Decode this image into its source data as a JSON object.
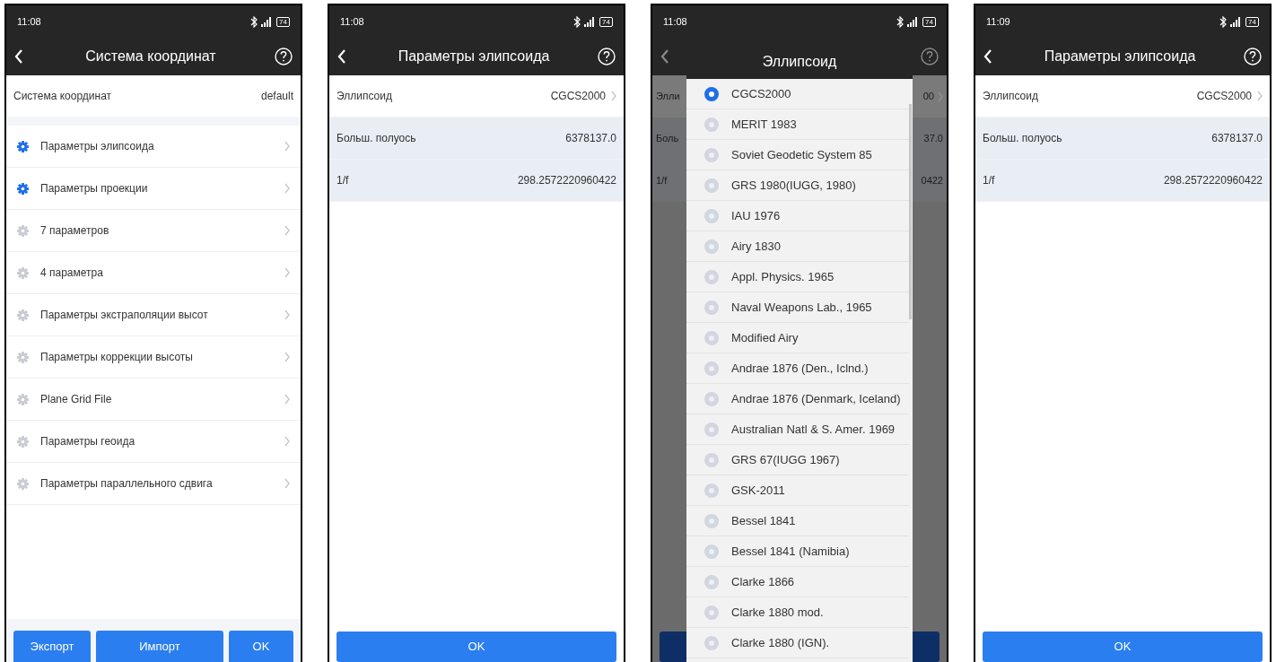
{
  "screens": [
    {
      "kind": "menu",
      "status": {
        "time": "11:08",
        "battery": "74"
      },
      "title": "Система координат",
      "header_row": {
        "label": "Система координат",
        "value": "default"
      },
      "items": [
        {
          "label": "Параметры элипсоида",
          "enabled": true
        },
        {
          "label": "Параметры проекции",
          "enabled": true
        },
        {
          "label": "7 параметров",
          "enabled": false
        },
        {
          "label": "4 параметра",
          "enabled": false
        },
        {
          "label": "Параметры экстраполяции высот",
          "enabled": false
        },
        {
          "label": "Параметры коррекции высоты",
          "enabled": false
        },
        {
          "label": "Plane Grid File",
          "enabled": false
        },
        {
          "label": "Параметры геоида",
          "enabled": false
        },
        {
          "label": "Параметры параллельного сдвига",
          "enabled": false
        }
      ],
      "buttons": [
        "Экспорт",
        "Импорт",
        "OK"
      ]
    },
    {
      "kind": "params",
      "status": {
        "time": "11:08",
        "battery": "74"
      },
      "title": "Параметры элипсоида",
      "rows": [
        {
          "kind": "select",
          "label": "Эллипсоид",
          "value": "CGCS2000"
        },
        {
          "kind": "value",
          "label": "Больш. полуось",
          "value": "6378137.0"
        },
        {
          "kind": "value",
          "label": "1/f",
          "value": "298.2572220960422"
        }
      ],
      "ok": "OK"
    },
    {
      "kind": "dialog",
      "status": {
        "time": "11:08",
        "battery": "74"
      },
      "background_rows": [
        {
          "kind": "select",
          "label": "Элли",
          "value": "00"
        },
        {
          "kind": "value",
          "label": "Боль",
          "value": "37.0"
        },
        {
          "kind": "value",
          "label": "1/f",
          "value": "0422"
        }
      ],
      "dialog": {
        "title": "Эллипсоид",
        "options": [
          {
            "label": "CGCS2000",
            "selected": true
          },
          {
            "label": "MERIT 1983",
            "selected": false
          },
          {
            "label": "Soviet Geodetic System 85",
            "selected": false
          },
          {
            "label": "GRS 1980(IUGG, 1980)",
            "selected": false
          },
          {
            "label": "IAU 1976",
            "selected": false
          },
          {
            "label": "Airy 1830",
            "selected": false
          },
          {
            "label": "Appl. Physics. 1965",
            "selected": false
          },
          {
            "label": "Naval Weapons Lab., 1965",
            "selected": false
          },
          {
            "label": "Modified Airy",
            "selected": false
          },
          {
            "label": "Andrae 1876 (Den., Iclnd.)",
            "selected": false
          },
          {
            "label": "Andrae 1876 (Denmark, Iceland)",
            "selected": false
          },
          {
            "label": "Australian Natl & S. Amer. 1969",
            "selected": false
          },
          {
            "label": "GRS 67(IUGG 1967)",
            "selected": false
          },
          {
            "label": "GSK-2011",
            "selected": false
          },
          {
            "label": "Bessel 1841",
            "selected": false
          },
          {
            "label": "Bessel 1841 (Namibia)",
            "selected": false
          },
          {
            "label": "Clarke 1866",
            "selected": false
          },
          {
            "label": "Clarke 1880 mod.",
            "selected": false
          },
          {
            "label": "Clarke 1880 (IGN).",
            "selected": false
          }
        ]
      }
    },
    {
      "kind": "params",
      "status": {
        "time": "11:09",
        "battery": "74"
      },
      "title": "Параметры элипсоида",
      "rows": [
        {
          "kind": "select",
          "label": "Эллипсоид",
          "value": "CGCS2000"
        },
        {
          "kind": "value",
          "label": "Больш. полуось",
          "value": "6378137.0"
        },
        {
          "kind": "value",
          "label": "1/f",
          "value": "298.2572220960422"
        }
      ],
      "ok": "OK"
    }
  ]
}
